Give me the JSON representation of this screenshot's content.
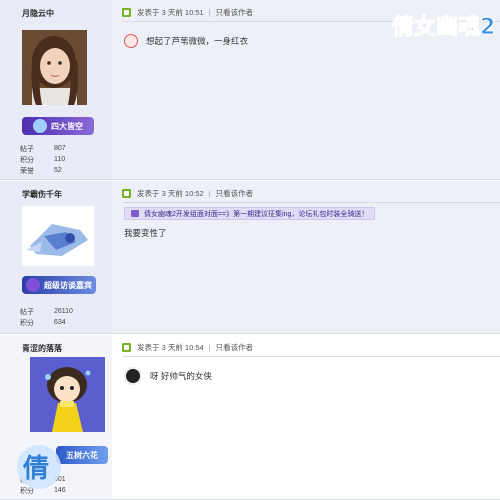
{
  "logo": {
    "text": "倩女幽魂2",
    "logo_text": "倩"
  },
  "posts": [
    {
      "author": "月隐云中",
      "badge": "四大皆空",
      "stats": [
        {
          "label": "帖子",
          "value": "807"
        },
        {
          "label": "积分",
          "value": "110"
        },
        {
          "label": "荣誉",
          "value": "52"
        }
      ],
      "posted": "发表于 3 天前 10:51",
      "view_author": "只看该作者",
      "content": "想起了芦苇微微，一身红衣",
      "quote": ""
    },
    {
      "author": "学霸伤千年",
      "badge": "超级访谈嘉宾",
      "stats": [
        {
          "label": "帖子",
          "value": "26110"
        },
        {
          "label": "积分",
          "value": "634"
        }
      ],
      "posted": "发表于 3 天前 10:52",
      "view_author": "只看该作者",
      "quote": "倩女幽魂2开发组面对面==》第一期建议征集ing，论坛礼包时装全骑送！",
      "content": "我要变性了"
    },
    {
      "author": "青涩的落落",
      "badge": "五树六花",
      "stats": [
        {
          "label": "帖子",
          "value": "601"
        },
        {
          "label": "积分",
          "value": "146"
        }
      ],
      "posted": "发表于 3 天前 10:54",
      "view_author": "只看该作者",
      "content": "呀 好帅气的女侠",
      "quote": ""
    }
  ],
  "colors": {
    "accent_green": "#7ab32a",
    "badge_purple": "#6a4fc9",
    "badge_blue": "#3a4fb8",
    "quote_bg": "#e1dcf6"
  }
}
